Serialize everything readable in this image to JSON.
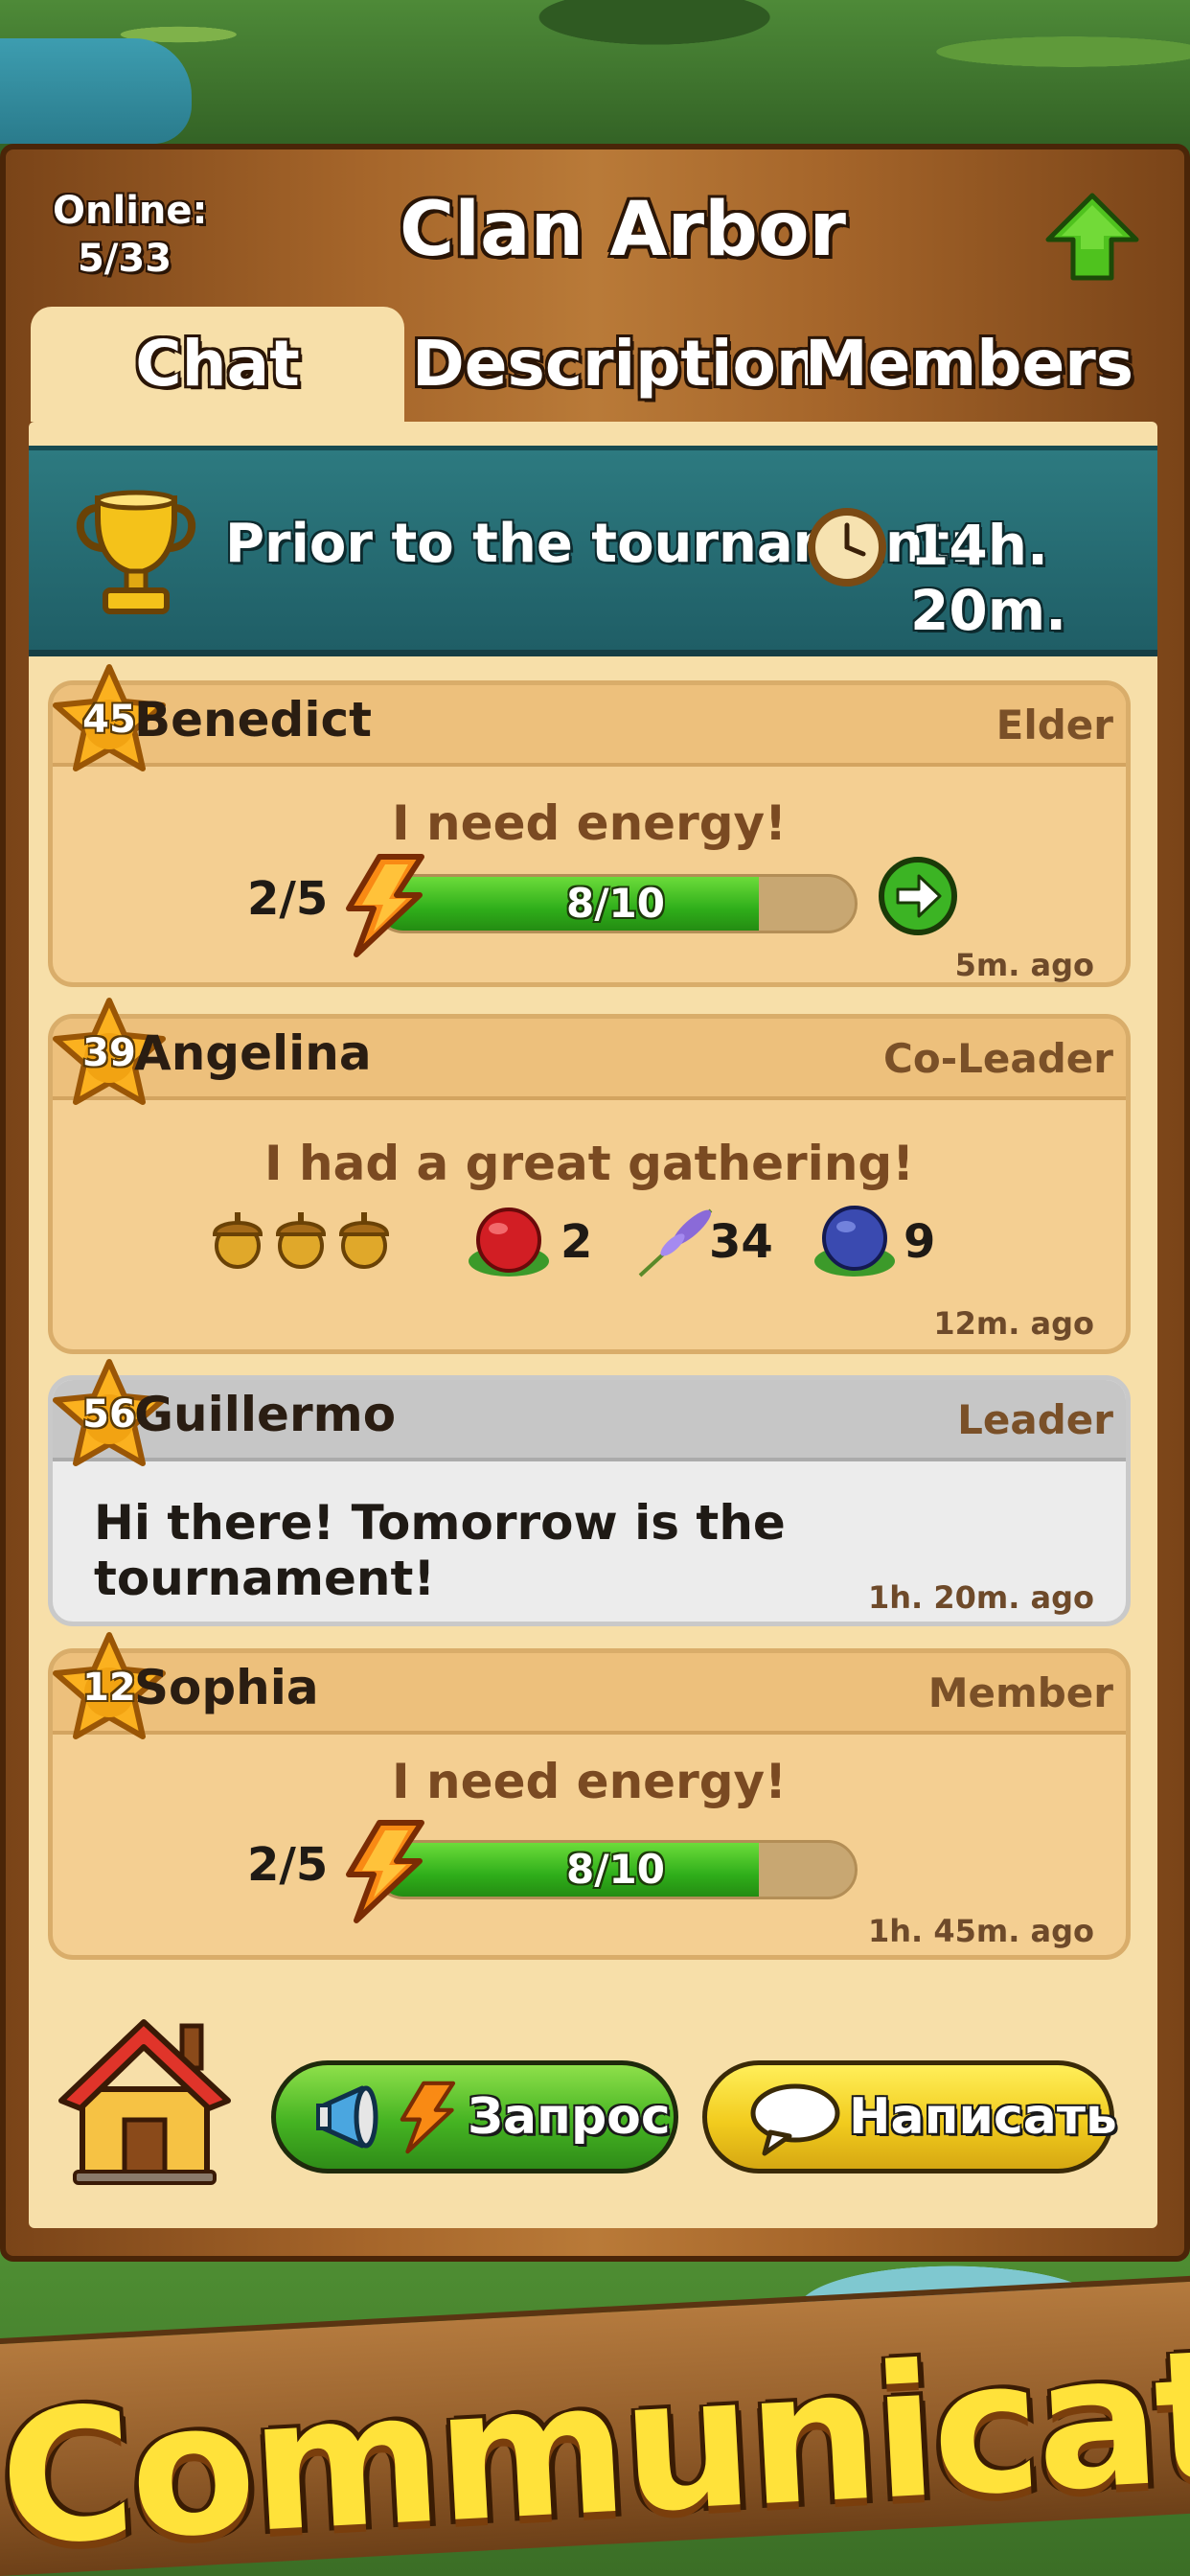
{
  "header": {
    "online_label": "Online:",
    "online_count": "5/33",
    "title": "Clan Arbor"
  },
  "tabs": [
    {
      "label": "Chat",
      "active": true
    },
    {
      "label": "Description",
      "active": false
    },
    {
      "label": "Members",
      "active": false
    }
  ],
  "banner": {
    "text": "Prior to the tournament:",
    "time": "14h. 20m."
  },
  "messages": [
    {
      "level": "45",
      "name": "Benedict",
      "role": "Elder",
      "text": "I need energy!",
      "requests": "2/5",
      "energy": "8/10",
      "energy_fraction": 0.8,
      "time": "5m. ago"
    },
    {
      "level": "39",
      "name": "Angelina",
      "role": "Co-Leader",
      "text": "I had a great gathering!",
      "items": {
        "cranberry": "2",
        "lavender": "34",
        "blueberry": "9"
      },
      "time": "12m. ago"
    },
    {
      "level": "56",
      "name": "Guillermo",
      "role": "Leader",
      "text": "Hi there! Tomorrow is the tournament!",
      "time": "1h. 20m. ago"
    },
    {
      "level": "12",
      "name": "Sophia",
      "role": "Member",
      "text": "I need energy!",
      "requests": "2/5",
      "energy": "8/10",
      "energy_fraction": 0.8,
      "time": "1h. 45m. ago"
    }
  ],
  "actions": {
    "request_label": "Запрос",
    "write_label": "Написать"
  },
  "promo_text": "Communicate!",
  "icons": [
    "up-arrow-icon",
    "trophy-icon",
    "clock-icon",
    "star-badge-icon",
    "lightning-icon",
    "arrow-right-icon",
    "acorn-icon",
    "cranberry-icon",
    "lavender-icon",
    "blueberry-icon",
    "house-icon",
    "megaphone-icon",
    "speech-bubble-icon"
  ]
}
